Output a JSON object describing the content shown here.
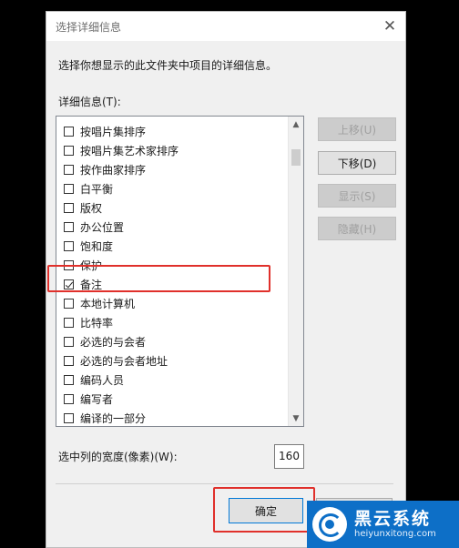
{
  "dialog": {
    "title": "选择详细信息",
    "close_glyph": "✕",
    "instruction": "选择你想显示的此文件夹中项目的详细信息。",
    "details_label": "详细信息(T):"
  },
  "details_list": [
    {
      "label": "按唱片集排序",
      "checked": false
    },
    {
      "label": "按唱片集艺术家排序",
      "checked": false
    },
    {
      "label": "按作曲家排序",
      "checked": false
    },
    {
      "label": "白平衡",
      "checked": false
    },
    {
      "label": "版权",
      "checked": false
    },
    {
      "label": "办公位置",
      "checked": false
    },
    {
      "label": "饱和度",
      "checked": false
    },
    {
      "label": "保护",
      "checked": false
    },
    {
      "label": "备注",
      "checked": true
    },
    {
      "label": "本地计算机",
      "checked": false
    },
    {
      "label": "比特率",
      "checked": false
    },
    {
      "label": "必选的与会者",
      "checked": false
    },
    {
      "label": "必选的与会者地址",
      "checked": false
    },
    {
      "label": "编码人员",
      "checked": false
    },
    {
      "label": "编写者",
      "checked": false
    },
    {
      "label": "编译的一部分",
      "checked": false
    }
  ],
  "side_buttons": {
    "move_up": "上移(U)",
    "move_down": "下移(D)",
    "show": "显示(S)",
    "hide": "隐藏(H)"
  },
  "width": {
    "label": "选中列的宽度(像素)(W):",
    "value": "160"
  },
  "footer": {
    "ok_label": "确定"
  },
  "watermark": {
    "name": "黑云系统",
    "url": "heiyunxitong.com"
  },
  "colors": {
    "highlight": "#e0302b",
    "watermark_bg": "#0d6fc7",
    "focus_border": "#0078d7"
  }
}
